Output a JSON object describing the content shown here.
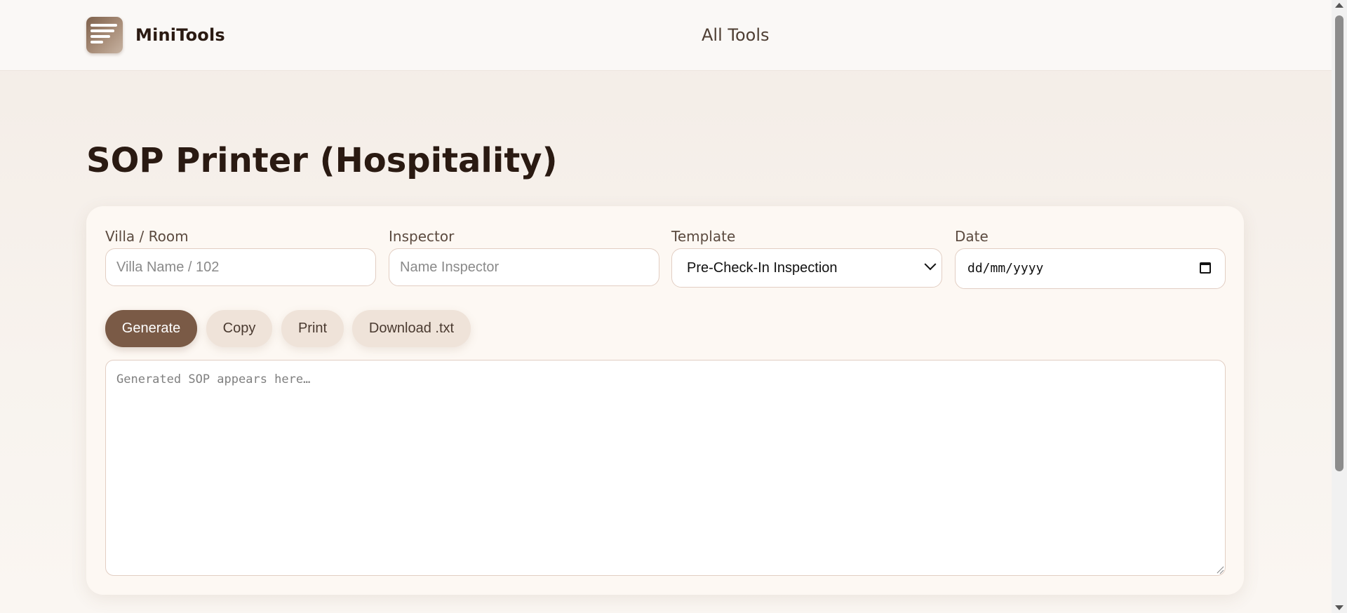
{
  "header": {
    "brand": "MiniTools",
    "logo_icon": "lines-icon",
    "nav_link": "All Tools"
  },
  "page": {
    "title": "SOP Printer (Hospitality)"
  },
  "form": {
    "villa": {
      "label": "Villa / Room",
      "placeholder": "Villa Name / 102",
      "value": ""
    },
    "inspector": {
      "label": "Inspector",
      "placeholder": "Name Inspector",
      "value": ""
    },
    "template": {
      "label": "Template",
      "selected": "Pre-Check-In Inspection"
    },
    "date": {
      "label": "Date",
      "value": "dd/mm/yyyy"
    }
  },
  "actions": {
    "generate": "Generate",
    "copy": "Copy",
    "print": "Print",
    "download": "Download .txt"
  },
  "output": {
    "placeholder": "Generated SOP appears here…"
  },
  "colors": {
    "accent": "#7a5a46",
    "secondary_button": "#efe3d9",
    "card": "#fdf8f3"
  }
}
